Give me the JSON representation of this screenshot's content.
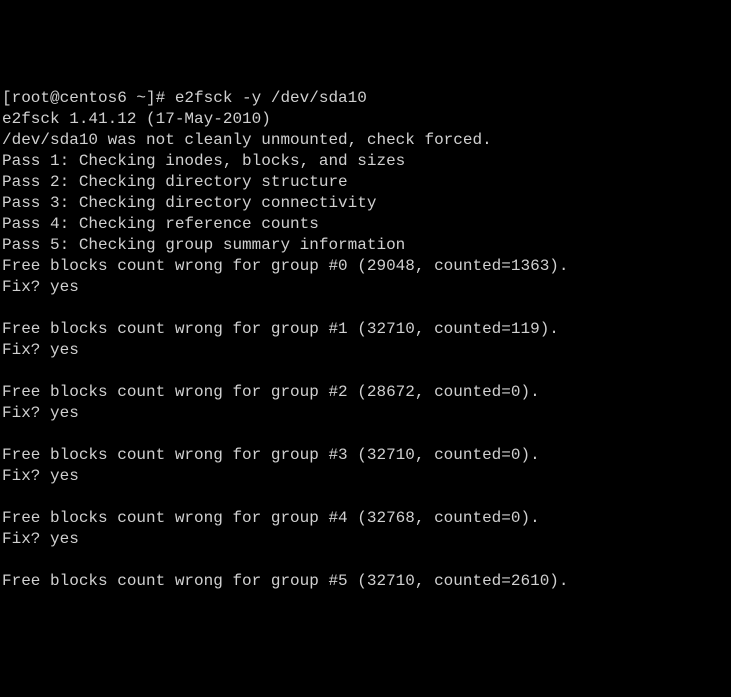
{
  "prompt": "[root@centos6 ~]# ",
  "command": "e2fsck -y /dev/sda10",
  "version_line": "e2fsck 1.41.12 (17-May-2010)",
  "mount_line": "/dev/sda10 was not cleanly unmounted, check forced.",
  "passes": [
    "Pass 1: Checking inodes, blocks, and sizes",
    "Pass 2: Checking directory structure",
    "Pass 3: Checking directory connectivity",
    "Pass 4: Checking reference counts",
    "Pass 5: Checking group summary information"
  ],
  "errors": [
    {
      "msg": "Free blocks count wrong for group #0 (29048, counted=1363).",
      "fix": "Fix? yes"
    },
    {
      "msg": "Free blocks count wrong for group #1 (32710, counted=119).",
      "fix": "Fix? yes"
    },
    {
      "msg": "Free blocks count wrong for group #2 (28672, counted=0).",
      "fix": "Fix? yes"
    },
    {
      "msg": "Free blocks count wrong for group #3 (32710, counted=0).",
      "fix": "Fix? yes"
    },
    {
      "msg": "Free blocks count wrong for group #4 (32768, counted=0).",
      "fix": "Fix? yes"
    },
    {
      "msg": "Free blocks count wrong for group #5 (32710, counted=2610).",
      "fix": ""
    }
  ]
}
